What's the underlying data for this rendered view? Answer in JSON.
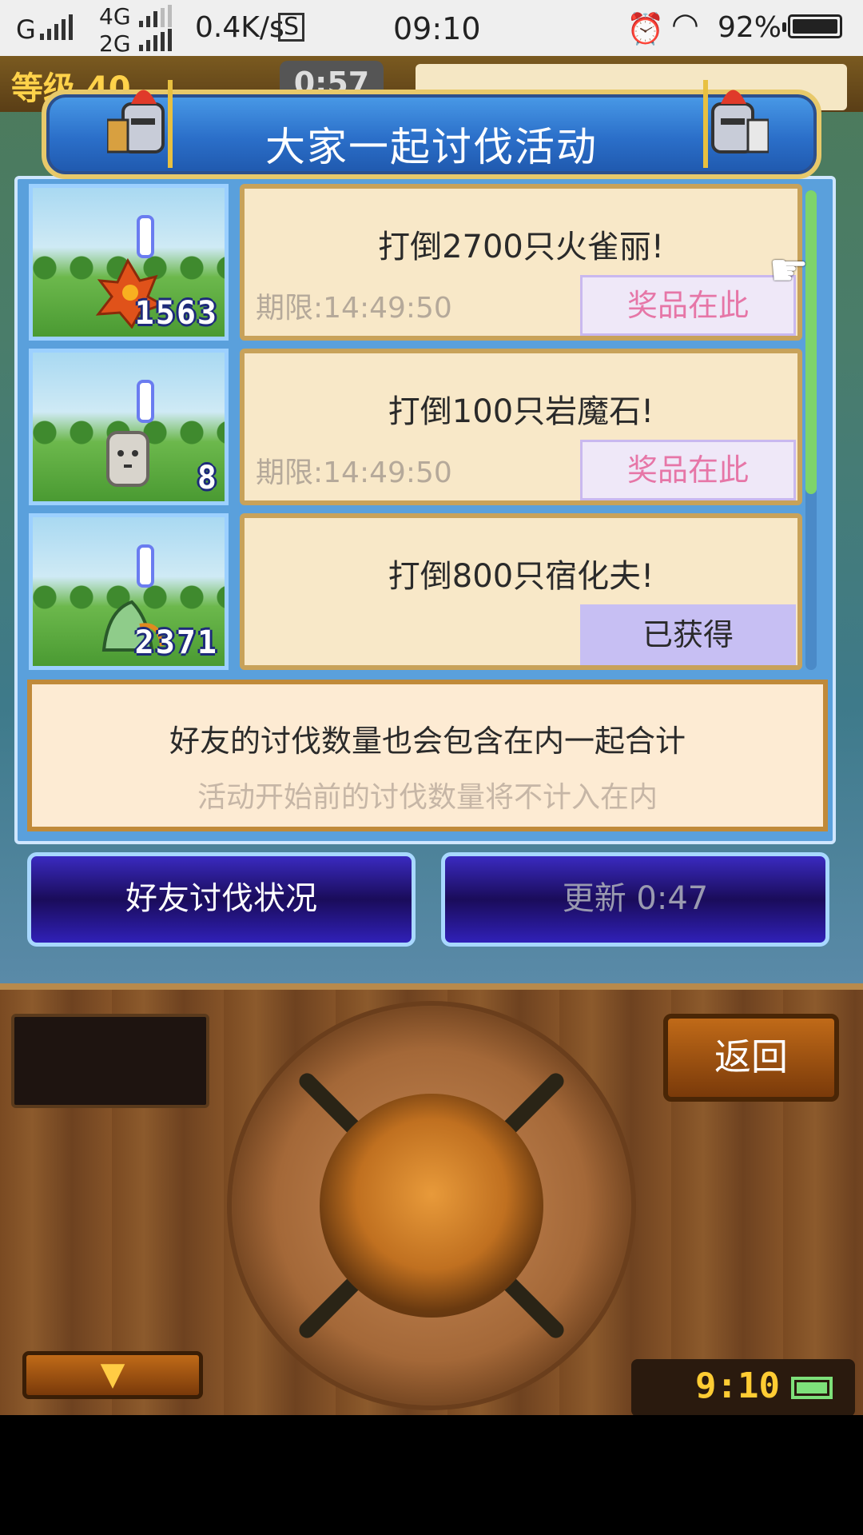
{
  "status_bar": {
    "carrier_1": "G",
    "carrier_2": "4G",
    "carrier_3": "2G",
    "net_speed": "0.4K/s",
    "time": "09:10",
    "battery": "92%"
  },
  "hud": {
    "level_label": "等级 40",
    "timer": "0:57"
  },
  "panel": {
    "title": "大家一起讨伐活动",
    "quests": [
      {
        "target": "打倒2700只火雀丽!",
        "deadline": "期限:14:49:50",
        "prize_label": "奖品在此",
        "kill_count": "1563",
        "status": "available"
      },
      {
        "target": "打倒100只岩魔石!",
        "deadline": "期限:14:49:50",
        "prize_label": "奖品在此",
        "kill_count": "8",
        "status": "available"
      },
      {
        "target": "打倒800只宿化夫!",
        "deadline": "",
        "prize_label": "已获得",
        "kill_count": "2371",
        "status": "obtained"
      }
    ],
    "info_line_1": "好友的讨伐数量也会包含在内一起合计",
    "info_line_2": "活动开始前的讨伐数量将不计入在内"
  },
  "buttons": {
    "friend_status": "好友讨伐状况",
    "refresh": "更新 0:47"
  },
  "controller": {
    "back_label": "返回",
    "down_arrow": "▼",
    "clock": "9:10"
  }
}
